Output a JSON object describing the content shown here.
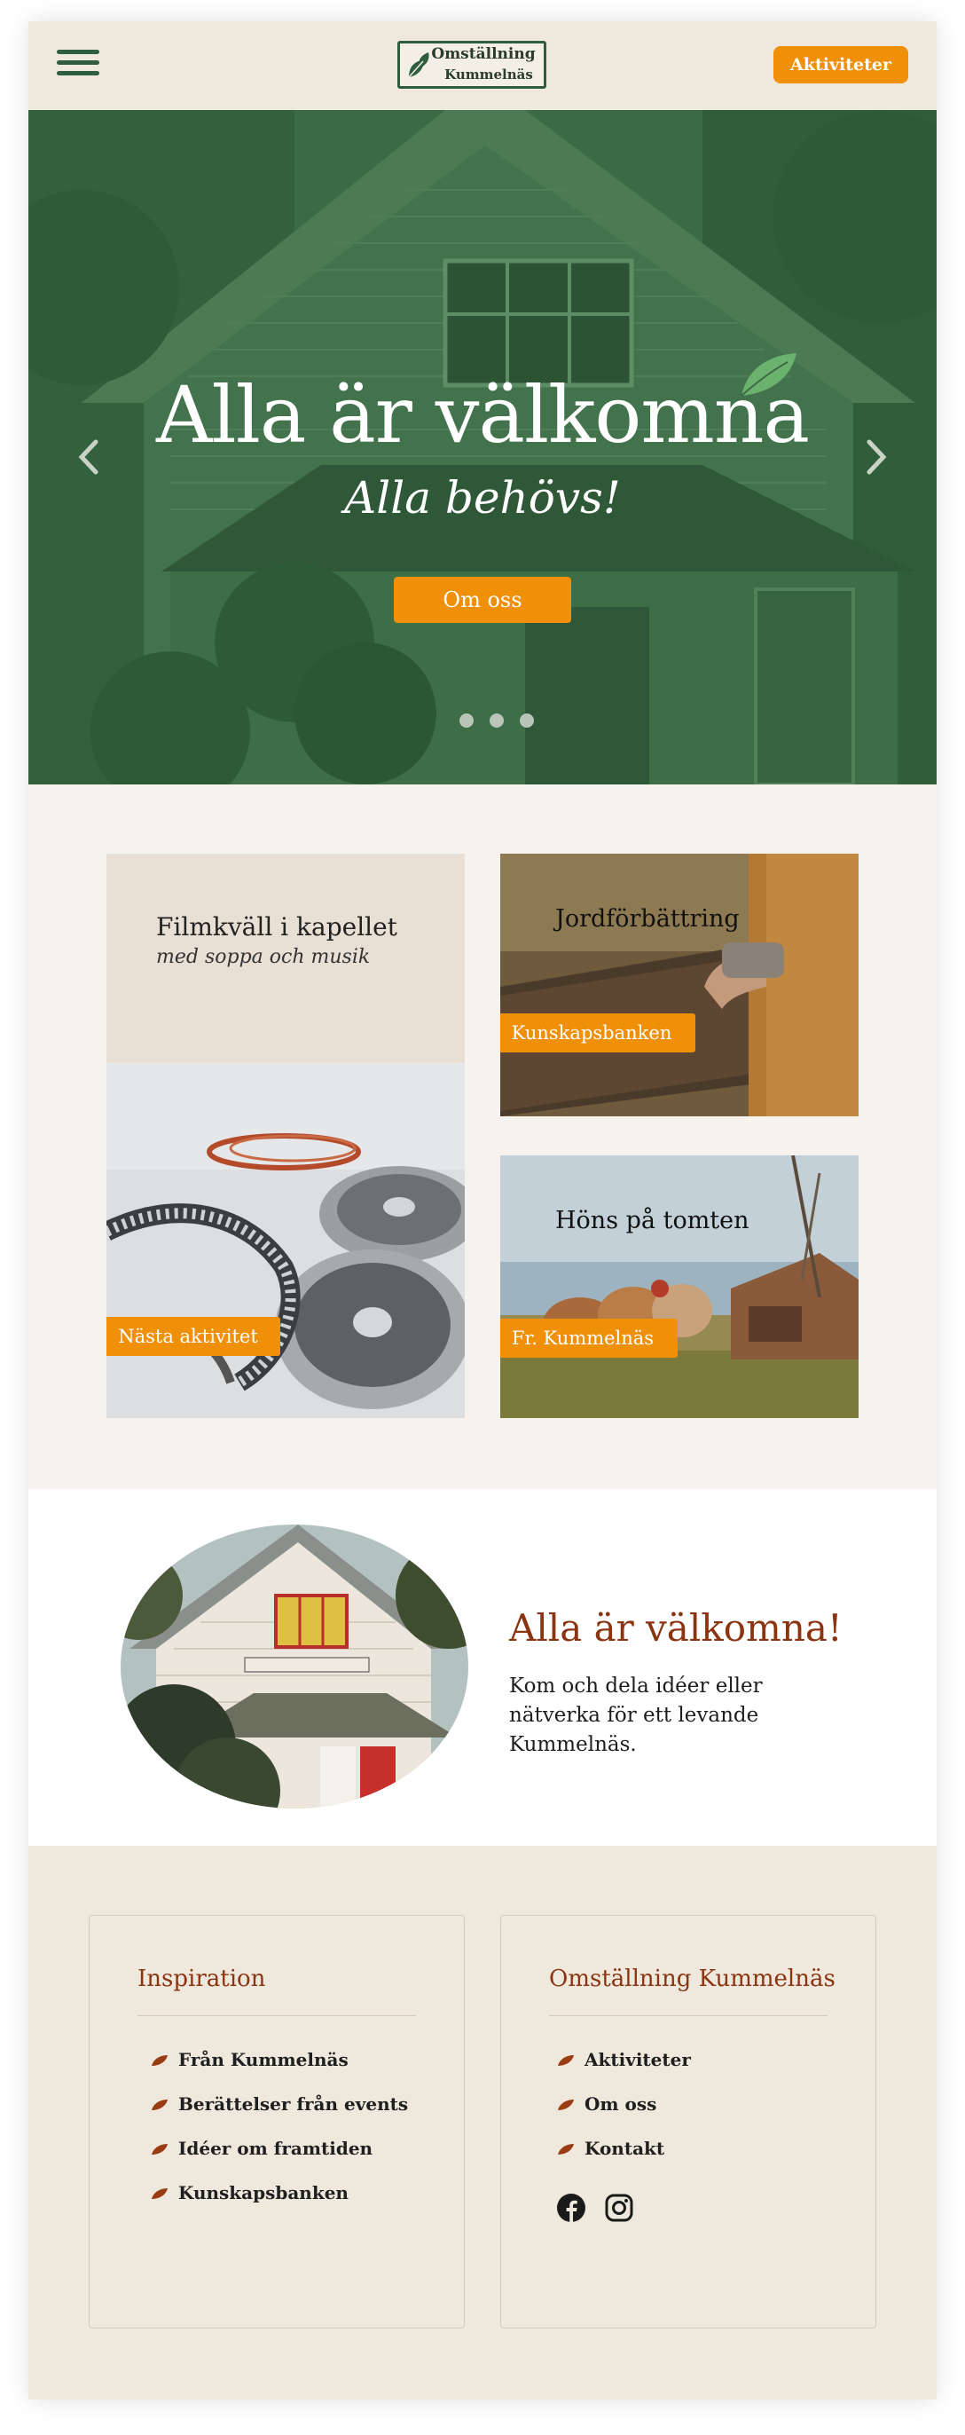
{
  "header": {
    "menu_label": "Meny",
    "logo_line1": "Omställning",
    "logo_line2": "Kummelnäs",
    "activities_button": "Aktiviteter"
  },
  "hero": {
    "title": "Alla är välkomna",
    "subtitle": "Alla behövs!",
    "button": "Om oss",
    "slide_count": 3,
    "active_slide": 1
  },
  "cards": {
    "featured": {
      "title": "Filmkväll i kapellet",
      "subtitle": "med soppa och musik",
      "tag": "Nästa aktivitet"
    },
    "items": [
      {
        "title": "Jordförbättring",
        "tag": "Kunskapsbanken"
      },
      {
        "title": "Höns på tomten",
        "tag": "Fr. Kummelnäs"
      }
    ]
  },
  "welcome": {
    "title": "Alla är välkomna!",
    "text": "Kom och dela idéer eller nätverka för ett levande Kummelnäs."
  },
  "footer": {
    "columns": [
      {
        "title": "Inspiration",
        "links": [
          "Från Kummelnäs",
          "Berättelser från events",
          "Idéer om framtiden",
          "Kunskapsbanken"
        ]
      },
      {
        "title": "Omställning Kummelnäs",
        "links": [
          "Aktiviteter",
          "Om oss",
          "Kontakt"
        ],
        "social": [
          "facebook-icon",
          "instagram-icon"
        ]
      }
    ]
  },
  "colors": {
    "brand_green": "#2f5e3e",
    "accent_orange": "#ef9008",
    "heading_brown": "#8a3411",
    "beige": "#efe8dc"
  }
}
